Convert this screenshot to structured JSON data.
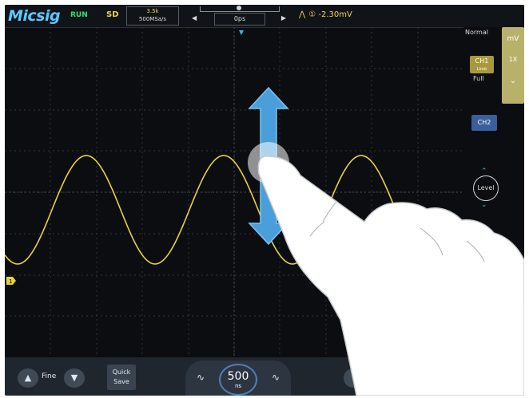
{
  "topbar": {
    "logo": "Micsig",
    "run_status": "RUN",
    "storage": "SD",
    "acq_line1": "3.5k",
    "acq_line2": "500MSa/s",
    "trigger_position": "0ps",
    "trigger_level": "-2.30mV"
  },
  "rightpanel": {
    "mode": "Normal",
    "ch1_label": "CH1",
    "ch1_sub": "Limit",
    "bandwidth": "Full",
    "ch2_label": "CH2",
    "level_label": "Level",
    "units": "mV",
    "probe": "1X"
  },
  "bottombar": {
    "fine_label": "Fine",
    "quick_save_line1": "Quick",
    "quick_save_line2": "Save",
    "timebase_value": "500",
    "timebase_unit": "ns"
  },
  "colors": {
    "ch1_trace": "#e8d23a",
    "accent_blue": "#4fa8e0",
    "background": "#0b0d10"
  }
}
